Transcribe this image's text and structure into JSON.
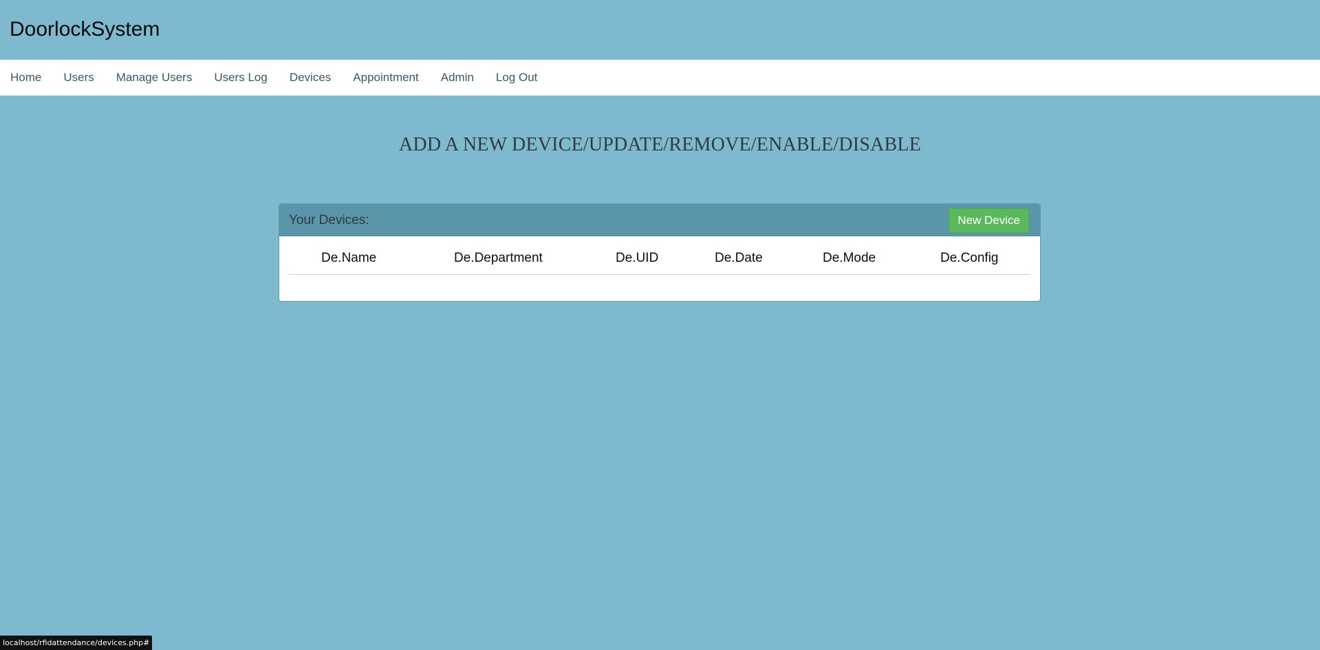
{
  "header": {
    "brand": "DoorlockSystem"
  },
  "nav": {
    "items": [
      {
        "label": "Home"
      },
      {
        "label": "Users"
      },
      {
        "label": "Manage Users"
      },
      {
        "label": "Users Log"
      },
      {
        "label": "Devices"
      },
      {
        "label": "Appointment"
      },
      {
        "label": "Admin"
      },
      {
        "label": "Log Out"
      }
    ]
  },
  "main": {
    "heading": "ADD A NEW DEVICE/UPDATE/REMOVE/ENABLE/DISABLE",
    "panel": {
      "title": "Your Devices:",
      "new_button_label": "New Device",
      "table": {
        "columns": [
          "De.Name",
          "De.Department",
          "De.UID",
          "De.Date",
          "De.Mode",
          "De.Config"
        ],
        "rows": []
      }
    }
  },
  "statusbar": {
    "url": "localhost/rfidattendance/devices.php#"
  },
  "colors": {
    "background": "#7fb9cf",
    "panel_header": "#5a95aa",
    "button_green": "#5cb85c"
  }
}
